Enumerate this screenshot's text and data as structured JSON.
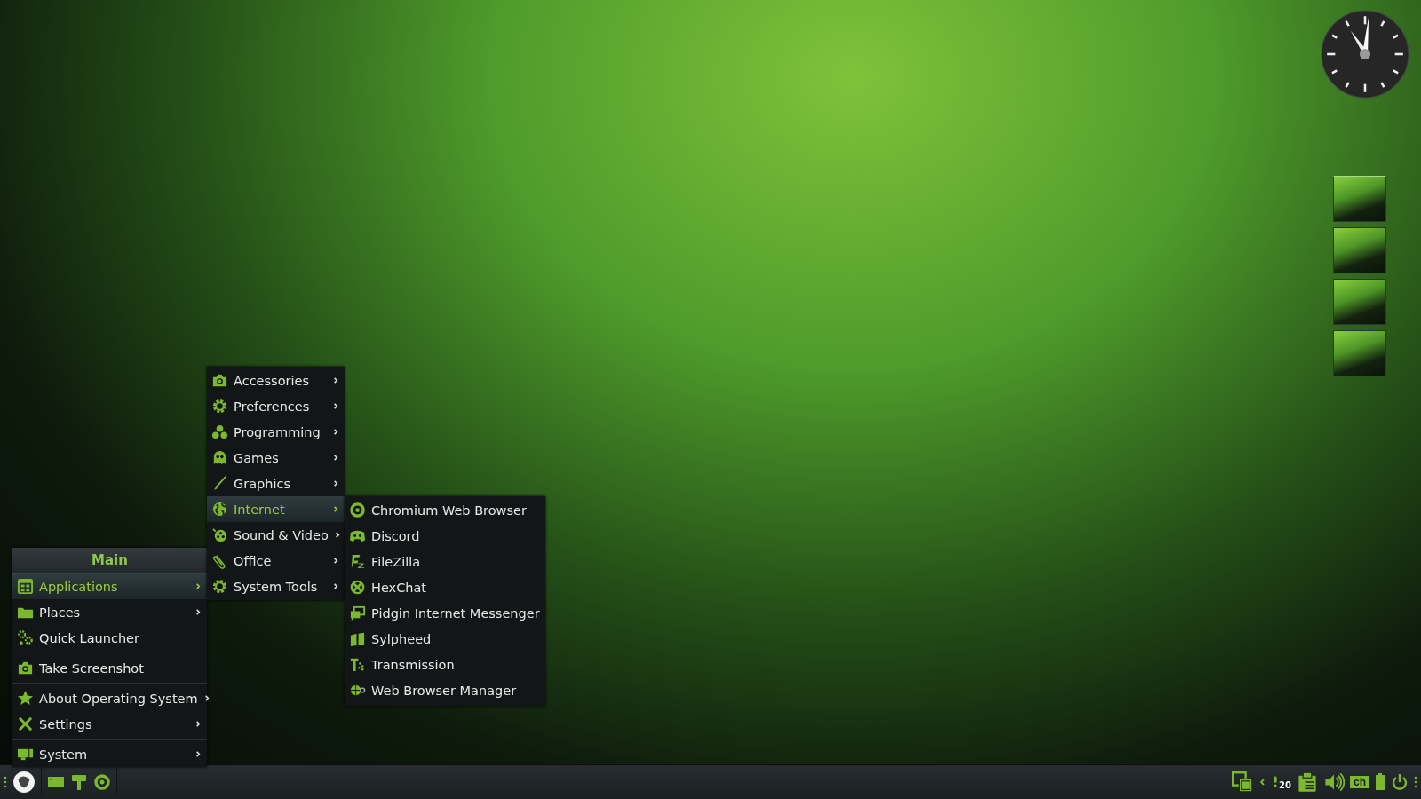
{
  "workspaces": [
    {
      "selected": true
    },
    {
      "selected": false
    },
    {
      "selected": false
    },
    {
      "selected": false
    }
  ],
  "main_menu": {
    "title": "Main",
    "items": [
      {
        "kind": "item",
        "label": "Applications",
        "submenu": true,
        "selected": true
      },
      {
        "kind": "item",
        "label": "Places",
        "submenu": true,
        "selected": false
      },
      {
        "kind": "item",
        "label": "Quick Launcher",
        "submenu": false,
        "selected": false
      },
      {
        "kind": "separator"
      },
      {
        "kind": "item",
        "label": "Take Screenshot",
        "submenu": false,
        "selected": false
      },
      {
        "kind": "separator"
      },
      {
        "kind": "item",
        "label": "About Operating System",
        "submenu": true,
        "selected": false
      },
      {
        "kind": "item",
        "label": "Settings",
        "submenu": true,
        "selected": false
      },
      {
        "kind": "separator"
      },
      {
        "kind": "item",
        "label": "System",
        "submenu": true,
        "selected": false
      }
    ]
  },
  "applications_menu": {
    "items": [
      {
        "label": "Accessories",
        "submenu": true,
        "selected": false
      },
      {
        "label": "Preferences",
        "submenu": true,
        "selected": false
      },
      {
        "label": "Programming",
        "submenu": true,
        "selected": false
      },
      {
        "label": "Games",
        "submenu": true,
        "selected": false
      },
      {
        "label": "Graphics",
        "submenu": true,
        "selected": false
      },
      {
        "label": "Internet",
        "submenu": true,
        "selected": true
      },
      {
        "label": "Sound & Video",
        "submenu": true,
        "selected": false
      },
      {
        "label": "Office",
        "submenu": true,
        "selected": false
      },
      {
        "label": "System Tools",
        "submenu": true,
        "selected": false
      }
    ]
  },
  "internet_menu": {
    "items": [
      {
        "label": "Chromium Web Browser",
        "selected": false
      },
      {
        "label": "Discord",
        "selected": false
      },
      {
        "label": "FileZilla",
        "selected": false
      },
      {
        "label": "HexChat",
        "selected": false
      },
      {
        "label": "Pidgin Internet Messenger",
        "selected": false
      },
      {
        "label": "Sylpheed",
        "selected": false
      },
      {
        "label": "Transmission",
        "selected": false
      },
      {
        "label": "Web Browser Manager",
        "selected": false
      }
    ]
  },
  "taskbar": {
    "tray": {
      "notification_count": "20",
      "keyboard_layout": "ch"
    }
  }
}
